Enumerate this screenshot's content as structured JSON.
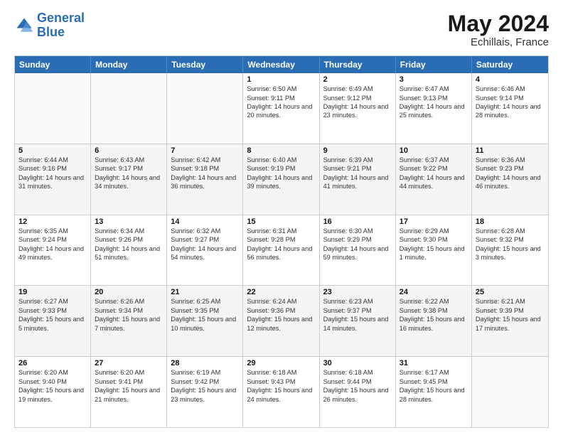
{
  "header": {
    "logo_general": "General",
    "logo_blue": "Blue",
    "month_year": "May 2024",
    "location": "Echillais, France"
  },
  "days_of_week": [
    "Sunday",
    "Monday",
    "Tuesday",
    "Wednesday",
    "Thursday",
    "Friday",
    "Saturday"
  ],
  "weeks": [
    [
      {
        "day": "",
        "sunrise": "",
        "sunset": "",
        "daylight": "",
        "empty": true
      },
      {
        "day": "",
        "sunrise": "",
        "sunset": "",
        "daylight": "",
        "empty": true
      },
      {
        "day": "",
        "sunrise": "",
        "sunset": "",
        "daylight": "",
        "empty": true
      },
      {
        "day": "1",
        "sunrise": "Sunrise: 6:50 AM",
        "sunset": "Sunset: 9:11 PM",
        "daylight": "Daylight: 14 hours and 20 minutes.",
        "empty": false
      },
      {
        "day": "2",
        "sunrise": "Sunrise: 6:49 AM",
        "sunset": "Sunset: 9:12 PM",
        "daylight": "Daylight: 14 hours and 23 minutes.",
        "empty": false
      },
      {
        "day": "3",
        "sunrise": "Sunrise: 6:47 AM",
        "sunset": "Sunset: 9:13 PM",
        "daylight": "Daylight: 14 hours and 25 minutes.",
        "empty": false
      },
      {
        "day": "4",
        "sunrise": "Sunrise: 6:46 AM",
        "sunset": "Sunset: 9:14 PM",
        "daylight": "Daylight: 14 hours and 28 minutes.",
        "empty": false
      }
    ],
    [
      {
        "day": "5",
        "sunrise": "Sunrise: 6:44 AM",
        "sunset": "Sunset: 9:16 PM",
        "daylight": "Daylight: 14 hours and 31 minutes.",
        "empty": false
      },
      {
        "day": "6",
        "sunrise": "Sunrise: 6:43 AM",
        "sunset": "Sunset: 9:17 PM",
        "daylight": "Daylight: 14 hours and 34 minutes.",
        "empty": false
      },
      {
        "day": "7",
        "sunrise": "Sunrise: 6:42 AM",
        "sunset": "Sunset: 9:18 PM",
        "daylight": "Daylight: 14 hours and 36 minutes.",
        "empty": false
      },
      {
        "day": "8",
        "sunrise": "Sunrise: 6:40 AM",
        "sunset": "Sunset: 9:19 PM",
        "daylight": "Daylight: 14 hours and 39 minutes.",
        "empty": false
      },
      {
        "day": "9",
        "sunrise": "Sunrise: 6:39 AM",
        "sunset": "Sunset: 9:21 PM",
        "daylight": "Daylight: 14 hours and 41 minutes.",
        "empty": false
      },
      {
        "day": "10",
        "sunrise": "Sunrise: 6:37 AM",
        "sunset": "Sunset: 9:22 PM",
        "daylight": "Daylight: 14 hours and 44 minutes.",
        "empty": false
      },
      {
        "day": "11",
        "sunrise": "Sunrise: 6:36 AM",
        "sunset": "Sunset: 9:23 PM",
        "daylight": "Daylight: 14 hours and 46 minutes.",
        "empty": false
      }
    ],
    [
      {
        "day": "12",
        "sunrise": "Sunrise: 6:35 AM",
        "sunset": "Sunset: 9:24 PM",
        "daylight": "Daylight: 14 hours and 49 minutes.",
        "empty": false
      },
      {
        "day": "13",
        "sunrise": "Sunrise: 6:34 AM",
        "sunset": "Sunset: 9:26 PM",
        "daylight": "Daylight: 14 hours and 51 minutes.",
        "empty": false
      },
      {
        "day": "14",
        "sunrise": "Sunrise: 6:32 AM",
        "sunset": "Sunset: 9:27 PM",
        "daylight": "Daylight: 14 hours and 54 minutes.",
        "empty": false
      },
      {
        "day": "15",
        "sunrise": "Sunrise: 6:31 AM",
        "sunset": "Sunset: 9:28 PM",
        "daylight": "Daylight: 14 hours and 56 minutes.",
        "empty": false
      },
      {
        "day": "16",
        "sunrise": "Sunrise: 6:30 AM",
        "sunset": "Sunset: 9:29 PM",
        "daylight": "Daylight: 14 hours and 59 minutes.",
        "empty": false
      },
      {
        "day": "17",
        "sunrise": "Sunrise: 6:29 AM",
        "sunset": "Sunset: 9:30 PM",
        "daylight": "Daylight: 15 hours and 1 minute.",
        "empty": false
      },
      {
        "day": "18",
        "sunrise": "Sunrise: 6:28 AM",
        "sunset": "Sunset: 9:32 PM",
        "daylight": "Daylight: 15 hours and 3 minutes.",
        "empty": false
      }
    ],
    [
      {
        "day": "19",
        "sunrise": "Sunrise: 6:27 AM",
        "sunset": "Sunset: 9:33 PM",
        "daylight": "Daylight: 15 hours and 5 minutes.",
        "empty": false
      },
      {
        "day": "20",
        "sunrise": "Sunrise: 6:26 AM",
        "sunset": "Sunset: 9:34 PM",
        "daylight": "Daylight: 15 hours and 7 minutes.",
        "empty": false
      },
      {
        "day": "21",
        "sunrise": "Sunrise: 6:25 AM",
        "sunset": "Sunset: 9:35 PM",
        "daylight": "Daylight: 15 hours and 10 minutes.",
        "empty": false
      },
      {
        "day": "22",
        "sunrise": "Sunrise: 6:24 AM",
        "sunset": "Sunset: 9:36 PM",
        "daylight": "Daylight: 15 hours and 12 minutes.",
        "empty": false
      },
      {
        "day": "23",
        "sunrise": "Sunrise: 6:23 AM",
        "sunset": "Sunset: 9:37 PM",
        "daylight": "Daylight: 15 hours and 14 minutes.",
        "empty": false
      },
      {
        "day": "24",
        "sunrise": "Sunrise: 6:22 AM",
        "sunset": "Sunset: 9:38 PM",
        "daylight": "Daylight: 15 hours and 16 minutes.",
        "empty": false
      },
      {
        "day": "25",
        "sunrise": "Sunrise: 6:21 AM",
        "sunset": "Sunset: 9:39 PM",
        "daylight": "Daylight: 15 hours and 17 minutes.",
        "empty": false
      }
    ],
    [
      {
        "day": "26",
        "sunrise": "Sunrise: 6:20 AM",
        "sunset": "Sunset: 9:40 PM",
        "daylight": "Daylight: 15 hours and 19 minutes.",
        "empty": false
      },
      {
        "day": "27",
        "sunrise": "Sunrise: 6:20 AM",
        "sunset": "Sunset: 9:41 PM",
        "daylight": "Daylight: 15 hours and 21 minutes.",
        "empty": false
      },
      {
        "day": "28",
        "sunrise": "Sunrise: 6:19 AM",
        "sunset": "Sunset: 9:42 PM",
        "daylight": "Daylight: 15 hours and 23 minutes.",
        "empty": false
      },
      {
        "day": "29",
        "sunrise": "Sunrise: 6:18 AM",
        "sunset": "Sunset: 9:43 PM",
        "daylight": "Daylight: 15 hours and 24 minutes.",
        "empty": false
      },
      {
        "day": "30",
        "sunrise": "Sunrise: 6:18 AM",
        "sunset": "Sunset: 9:44 PM",
        "daylight": "Daylight: 15 hours and 26 minutes.",
        "empty": false
      },
      {
        "day": "31",
        "sunrise": "Sunrise: 6:17 AM",
        "sunset": "Sunset: 9:45 PM",
        "daylight": "Daylight: 15 hours and 28 minutes.",
        "empty": false
      },
      {
        "day": "",
        "sunrise": "",
        "sunset": "",
        "daylight": "",
        "empty": true
      }
    ]
  ]
}
